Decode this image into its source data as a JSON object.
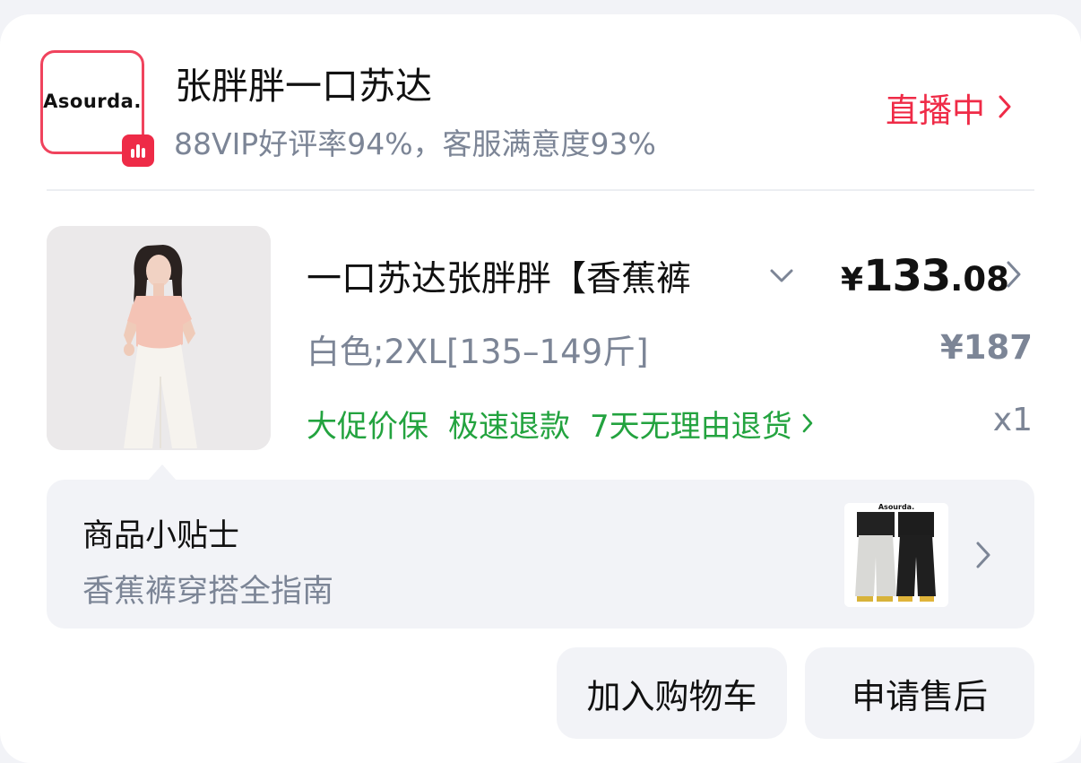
{
  "shop": {
    "logo_text": "Asourda.",
    "name": "张胖胖一口苏达",
    "rating": "88VIP好评率94%，客服满意度93%",
    "live_label": "直播中",
    "live_chevron_icon": "chevron-right-icon",
    "live_badge_icon": "live-bars-icon",
    "accent_color": "#ef2b47"
  },
  "product": {
    "title": "一口苏达张胖胖【香蕉裤",
    "title_dropdown_icon": "chevron-down-icon",
    "price_currency": "¥",
    "price_integer": "133",
    "price_decimal": ".08",
    "price_chevron_icon": "chevron-right-icon",
    "spec": "白色;2XL[135–149斤]",
    "original_price": "¥187",
    "tags": [
      "大促价保",
      "极速退款",
      "7天无理由退货"
    ],
    "tags_chevron_icon": "chevron-right-icon",
    "tag_color": "#23a33f",
    "quantity": "x1"
  },
  "tips": {
    "title": "商品小贴士",
    "subtitle": "香蕉裤穿搭全指南",
    "thumb_logo_text": "Asourda.",
    "chevron_icon": "chevron-right-icon"
  },
  "actions": {
    "add_to_cart": "加入购物车",
    "after_sales": "申请售后"
  }
}
